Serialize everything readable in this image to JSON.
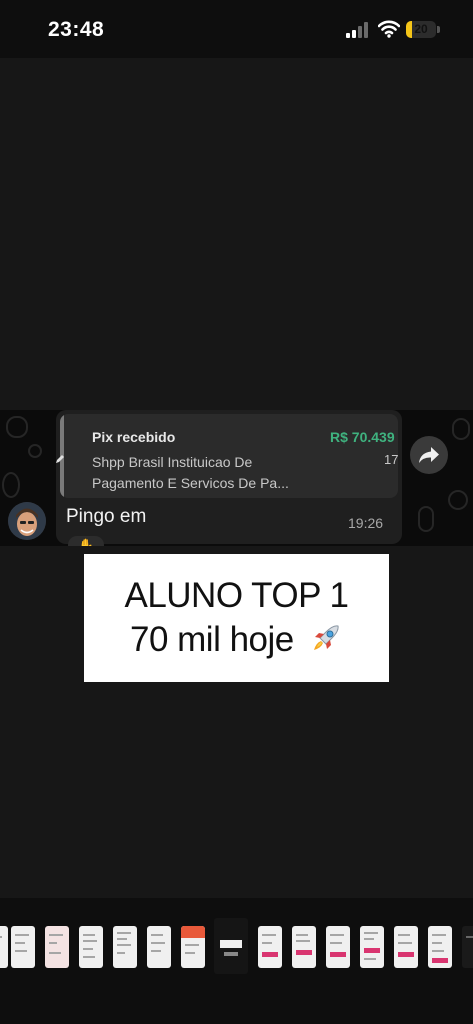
{
  "status_bar": {
    "time": "23:48",
    "battery_level": "20",
    "signal_icon": "cellular-signal-icon",
    "wifi_icon": "wifi-icon",
    "battery_icon": "battery-icon"
  },
  "chat": {
    "quoted_payment": {
      "title": "Pix recebido",
      "amount": "R$ 70.439",
      "description": "Shpp Brasil Instituicao De Pagamento E Servicos De Pa...",
      "time_fragment": "17"
    },
    "message_text": "Pingo em",
    "message_time": "19:26",
    "forward_icon": "forward-arrow-icon",
    "reaction_icon": "hand-emoji-icon"
  },
  "caption": {
    "line1": "ALUNO TOP 1",
    "line2": "70 mil hoje",
    "emoji": "rocket-icon"
  },
  "colors": {
    "amount_green": "#3fb27f",
    "battery_yellow": "#f5c518",
    "thumb_accent": "#d93570",
    "thumb_accent_orange": "#e8593a"
  }
}
